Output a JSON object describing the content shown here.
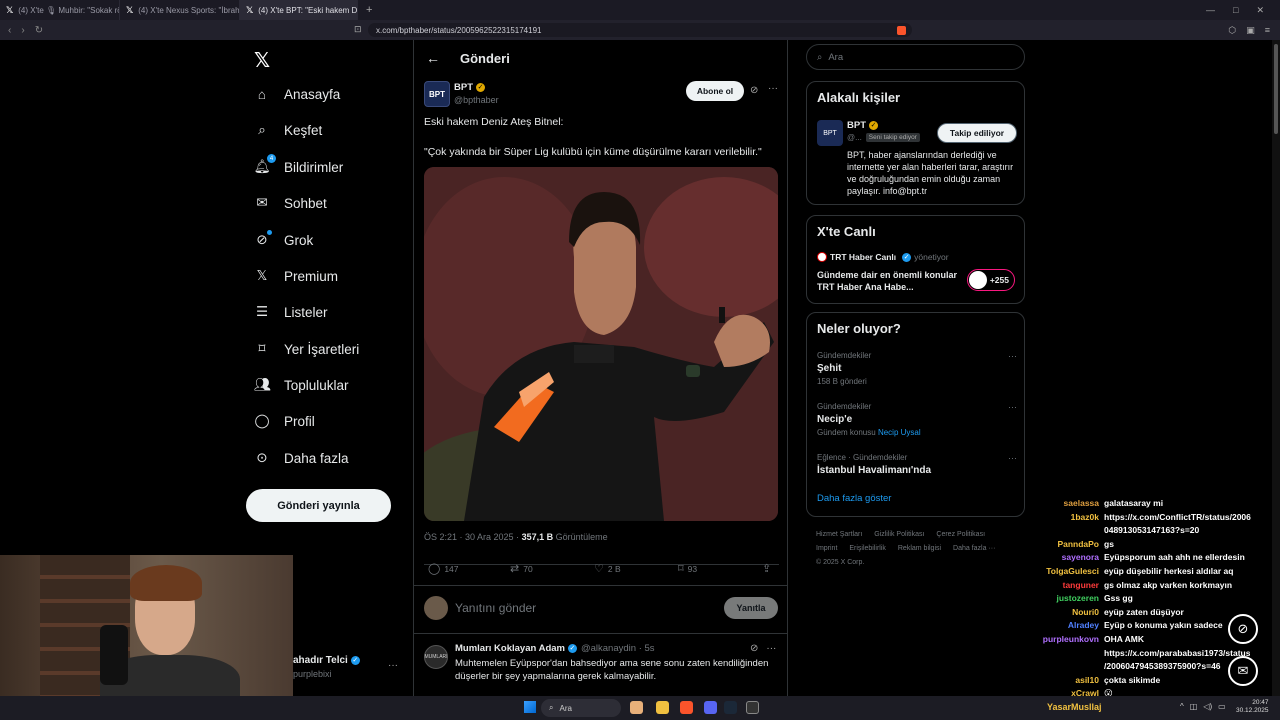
{
  "browser": {
    "tabs": [
      {
        "label": "(4) X'te 🎙 Muhbir: \"Sokak röportaj\""
      },
      {
        "label": "(4) X'te Nexus Sports: \"İbrahim Seten\""
      },
      {
        "label": "(4) X'te BPT: \"Eski hakem Deniz\"",
        "active": true
      }
    ],
    "url": "x.com/bpthaber/status/2005962522315174191"
  },
  "sidebar": {
    "items": [
      {
        "label": "Anasayfa",
        "icon": "home-icon"
      },
      {
        "label": "Keşfet",
        "icon": "search-icon"
      },
      {
        "label": "Bildirimler",
        "icon": "bell-icon",
        "badge": "4"
      },
      {
        "label": "Sohbet",
        "icon": "mail-icon"
      },
      {
        "label": "Grok",
        "icon": "grok-icon"
      },
      {
        "label": "Premium",
        "icon": "x-icon"
      },
      {
        "label": "Listeler",
        "icon": "list-icon"
      },
      {
        "label": "Yer İşaretleri",
        "icon": "bookmark-icon"
      },
      {
        "label": "Topluluklar",
        "icon": "people-icon"
      },
      {
        "label": "Profil",
        "icon": "person-icon"
      },
      {
        "label": "Daha fazla",
        "icon": "more-circle-icon"
      }
    ],
    "post_button": "Gönderi yayınla"
  },
  "me": {
    "name": "ahadır Telci",
    "handle": "purplebixi"
  },
  "main": {
    "title": "Gönderi",
    "post": {
      "author": "BPT",
      "handle": "@bpthaber",
      "avatar_text": "BPT",
      "subscribe_label": "Abone ol",
      "text_line1": "Eski hakem Deniz Ateş Bitnel:",
      "text_line2": "\"Çok yakında bir Süper Lig kulübü için küme düşürülme kararı verilebilir.\"",
      "time": "ÖS 2:21 · 30 Ara 2025 · ",
      "views": "357,1 B",
      "views_label": " Görüntüleme",
      "replies": "147",
      "reposts": "70",
      "likes": "2 B",
      "bookmarks": "93"
    },
    "reply_placeholder": "Yanıtını gönder",
    "reply_button": "Yanıtla",
    "comment": {
      "author": "Mumları Koklayan Adam",
      "handle": "@alkanaydin · 5s",
      "avatar_text": "MUMLARI",
      "text": "Muhtemelen Eyüpspor'dan bahsediyor ama sene sonu zaten kendiliğinden düşerler bir şey yapmalarına gerek kalmayabilir."
    }
  },
  "right": {
    "search_placeholder": "Ara",
    "related": {
      "title": "Alakalı kişiler",
      "name": "BPT",
      "handle": "@...",
      "follows_you": "Seni takip ediyor",
      "follow_button": "Takip ediliyor",
      "bio": "BPT, haber ajanslarından derlediği ve internette yer alan haberleri tarar, araştırır ve doğruluğundan emin olduğu zaman paylaşır. info@bpt.tr"
    },
    "live": {
      "title": "X'te Canlı",
      "source": "TRT Haber Canlı",
      "role": "yönetiyor",
      "text": "Gündeme dair en önemli konular TRT Haber Ana Habe...",
      "count": "+255"
    },
    "trends": {
      "title": "Neler oluyor?",
      "items": [
        {
          "category": "Gündemdekiler",
          "name": "Şehit",
          "sub": "158 B gönderi"
        },
        {
          "category": "Gündemdekiler",
          "name": "Necip'e",
          "sub": "Gündem konusu",
          "link": "Necip Uysal"
        },
        {
          "category": "Eğlence · Gündemdekiler",
          "name": "İstanbul Havalimanı'nda",
          "sub": ""
        }
      ],
      "show_more": "Daha fazla göster"
    },
    "footer": [
      "Hizmet Şartları",
      "Gizlilik Politikası",
      "Çerez Politikası",
      "Imprint",
      "Erişilebilirlik",
      "Reklam bilgisi",
      "Daha fazla ···",
      "© 2025 X Corp."
    ]
  },
  "chat": [
    {
      "user": "saelassa",
      "msg": "galatasaray mi",
      "color": "#e0a040"
    },
    {
      "user": "1baz0k",
      "msg": "https://x.com/ConflictTR/status/2006",
      "color": "#f0c040"
    },
    {
      "user": "",
      "msg": "048913053147163?s=20",
      "color": "#f0c040"
    },
    {
      "user": "PanndaPo",
      "msg": "gs",
      "color": "#f0c040"
    },
    {
      "user": "sayenora",
      "msg": "Eyüpsporum aah ahh ne ellerdesin",
      "color": "#b070ff"
    },
    {
      "user": "TolgaGulesci",
      "msg": "eyüp düşebilir herkesi aldılar aq",
      "color": "#f0c040"
    },
    {
      "user": "tanguner",
      "msg": "gs olmaz akp varken korkmayın",
      "color": "#ff3b3b"
    },
    {
      "user": "justozeren",
      "msg": "Gss gg",
      "color": "#40d060"
    },
    {
      "user": "Nouri0",
      "msg": "eyüp zaten düşüyor",
      "color": "#f0c040"
    },
    {
      "user": "Alradey",
      "msg": "Eyüp o konuma yakın sadece",
      "color": "#5080ff"
    },
    {
      "user": "purpleunkovn",
      "msg": "OHA AMK",
      "color": "#b070ff"
    },
    {
      "user": "",
      "msg": "https://x.com/parababasi1973/status",
      "color": "#b070ff"
    },
    {
      "user": "",
      "msg": "/2006047945389375900?s=46",
      "color": "#b070ff"
    },
    {
      "user": "asil10",
      "msg": "çokta sikimde",
      "color": "#f0c040"
    },
    {
      "user": "xCrawl",
      "msg": "😮",
      "color": "#f0c040"
    }
  ],
  "taskbar": {
    "search": "Ara",
    "user": "YasarMusllaj",
    "time": "20:47",
    "date": "30.12.2025"
  }
}
